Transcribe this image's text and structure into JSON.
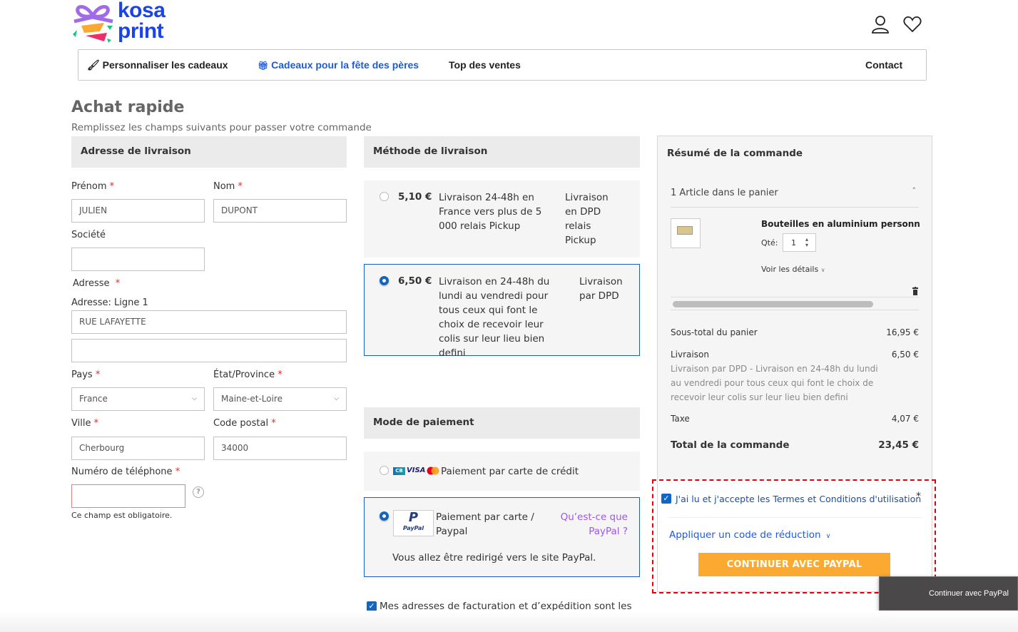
{
  "header": {
    "logo_line1": "kosa",
    "logo_line2": "print",
    "account_icon": "user-icon",
    "wishlist_icon": "heart-icon"
  },
  "nav": {
    "items": [
      {
        "label": "Personnaliser les cadeaux",
        "icon": "brush-icon"
      },
      {
        "label": "Cadeaux pour la fête des pères",
        "icon": "gift-icon",
        "color": "#1a5be6"
      },
      {
        "label": "Top des ventes"
      },
      {
        "label": "Contact"
      }
    ]
  },
  "page": {
    "title": "Achat rapide",
    "subtitle": "Remplissez les champs suivants pour passer votre commande"
  },
  "shipping_address": {
    "heading": "Adresse de livraison",
    "required_mark": "*",
    "fields": {
      "firstname": {
        "label": "Prénom",
        "value": "JULIEN"
      },
      "lastname": {
        "label": "Nom",
        "value": "DUPONT"
      },
      "company": {
        "label": "Société",
        "value": ""
      },
      "address_group_label": "Adresse",
      "street1": {
        "label": "Adresse: Ligne 1",
        "value": "RUE LAFAYETTE"
      },
      "street2": {
        "value": ""
      },
      "country": {
        "label": "Pays",
        "value": "France"
      },
      "region": {
        "label": "État/Province",
        "value": "Maine-et-Loire"
      },
      "city": {
        "label": "Ville",
        "value": "Cherbourg"
      },
      "postcode": {
        "label": "Code postal",
        "value": "34000"
      },
      "telephone": {
        "label": "Numéro de téléphone",
        "value": "",
        "error": "Ce champ est obligatoire.",
        "help_icon": "question-circle-icon"
      }
    }
  },
  "shipping_method": {
    "heading": "Méthode de livraison",
    "options": [
      {
        "price": "5,10 €",
        "description": "Livraison 24-48h en France vers plus de 5 000 relais Pickup",
        "carrier": "Livraison en DPD relais Pickup",
        "selected": false
      },
      {
        "price": "6,50 €",
        "description": "Livraison en 24-48h du lundi au vendredi pour tous ceux qui font le choix de recevoir leur colis sur leur lieu bien defini",
        "carrier": "Livraison par DPD",
        "selected": true
      }
    ]
  },
  "payment": {
    "heading": "Mode de paiement",
    "options": [
      {
        "label": "Paiement par carte de crédit",
        "icons": [
          "cb-icon",
          "visa-icon",
          "mastercard-icon"
        ],
        "selected": false
      },
      {
        "label": "Paiement par carte / Paypal",
        "icon": "paypal-icon",
        "link": "Qu’est-ce que PayPal ?",
        "note": "Vous allez être redirigé vers le site PayPal.",
        "selected": true
      }
    ],
    "same_address_label": "Mes adresses de facturation et d’expédition sont les mêmes",
    "same_address_checked": true
  },
  "summary": {
    "heading": "Résumé de la commande",
    "items_count_label": "1 Article dans le panier",
    "item": {
      "name": "Bouteilles en aluminium personnalis",
      "qty_label": "Qté:",
      "qty": "1",
      "details_label": "Voir les détails"
    },
    "subtotal_label": "Sous-total du panier",
    "subtotal": "16,95 €",
    "shipping_label": "Livraison",
    "shipping": "6,50 €",
    "shipping_desc": "Livraison par DPD - Livraison en 24-48h du lundi au vendredi pour tous ceux qui font le choix de recevoir leur colis sur leur lieu bien defini",
    "tax_label": "Taxe",
    "tax": "4,07 €",
    "total_label": "Total de la commande",
    "total": "23,45 €",
    "terms_label": "J'ai lu et j'accepte les Termes et Conditions d'utilisation",
    "terms_checked": true,
    "discount_label": "Appliquer un code de réduction",
    "cta_label": "CONTINUER AVEC PAYPAL",
    "tooltip": "Continuer avec PayPal"
  },
  "colors": {
    "brand_blue": "#1a44e8",
    "accent_blue": "#1166c2",
    "cta_orange": "#fba930",
    "required_red": "#e02b27",
    "paypal_link": "#9b59e8"
  }
}
